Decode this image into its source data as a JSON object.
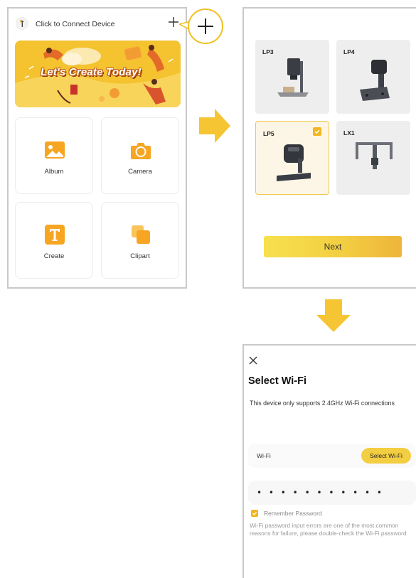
{
  "home": {
    "connect_text": "Click to Connect Device",
    "banner_title": "Let's Create Today!",
    "tiles": [
      {
        "label": "Album",
        "icon": "image-icon"
      },
      {
        "label": "Camera",
        "icon": "camera-icon"
      },
      {
        "label": "Create",
        "icon": "text-icon"
      },
      {
        "label": "Clipart",
        "icon": "clipart-icon"
      }
    ]
  },
  "device_select": {
    "devices": [
      {
        "label": "LP3",
        "selected": false
      },
      {
        "label": "LP4",
        "selected": false
      },
      {
        "label": "LP5",
        "selected": true
      },
      {
        "label": "LX1",
        "selected": false
      }
    ],
    "next_label": "Next"
  },
  "wifi": {
    "title": "Select Wi-Fi",
    "note": "This device only supports 2.4GHz Wi-Fi connections",
    "wifi_label": "Wi-Fi",
    "select_label": "Select Wi-Fi",
    "password_mask": "• • • • • • • • • • •",
    "remember_label": "Remember Password",
    "hint": "Wi-Fi password input errors are one of the most common reasons for failure, please double-check the Wi-Fi password"
  },
  "colors": {
    "accent": "#f3ce42",
    "accent_dark": "#f1b51f",
    "icon_orange": "#f6a623",
    "border": "#c9c9c9"
  }
}
